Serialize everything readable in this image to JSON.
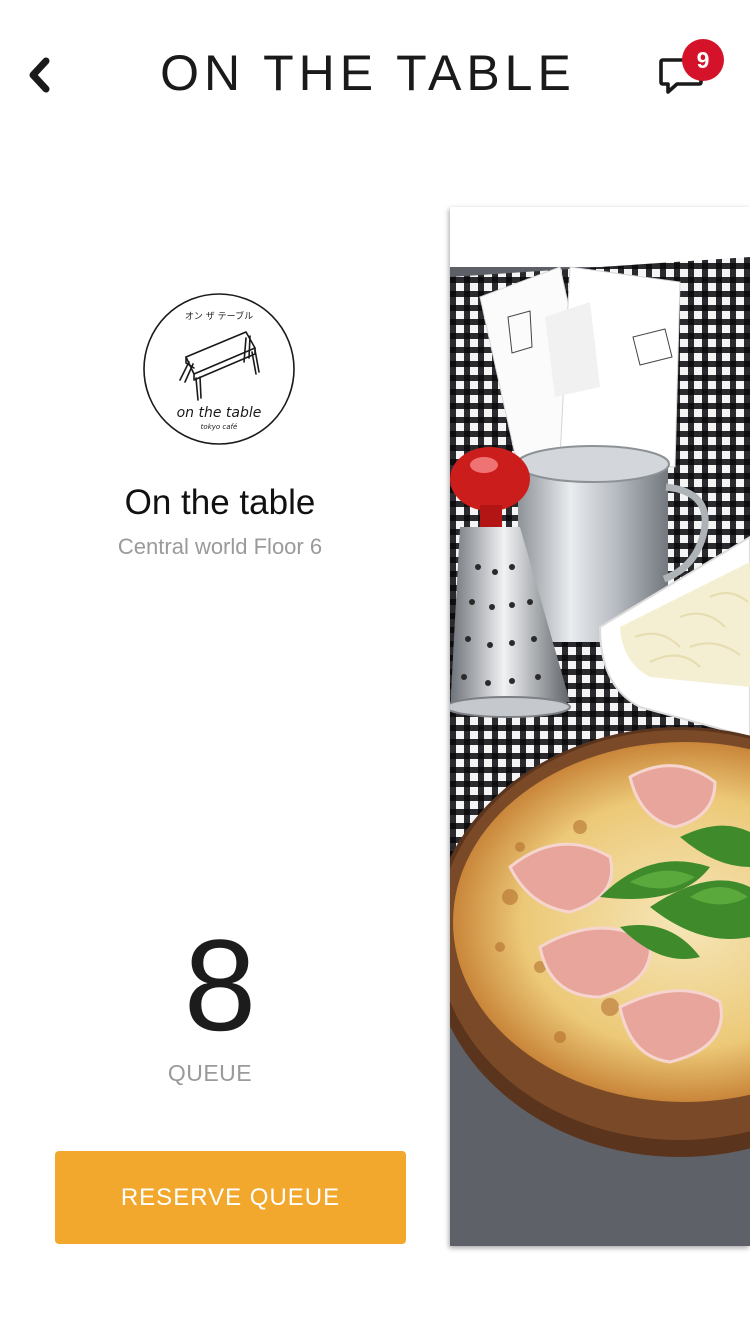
{
  "header": {
    "title": "ON THE TABLE",
    "back_icon": "chevron-left-icon",
    "chat_icon": "chat-bubble-icon",
    "notification_count": "9",
    "badge_color": "#d4132a"
  },
  "restaurant": {
    "logo": {
      "top_text": "オン ザ テーブル",
      "brand_text": "on the table",
      "sub_text": "tokyo café"
    },
    "name": "On the table",
    "location": "Central world Floor 6"
  },
  "queue": {
    "count": "8",
    "label": "QUEUE"
  },
  "actions": {
    "reserve_label": "RESERVE QUEUE",
    "reserve_color": "#f2a82c"
  },
  "photo": {
    "subject": "pizza-with-prosciutto-and-arugula"
  }
}
